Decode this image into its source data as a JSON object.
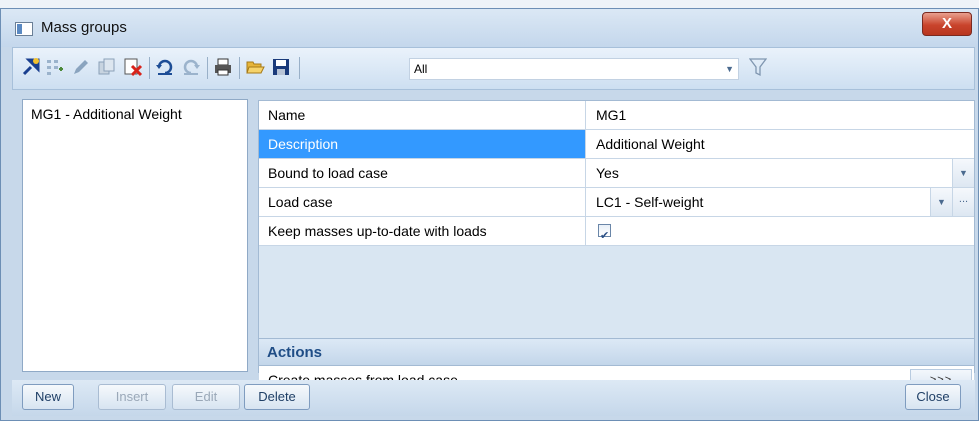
{
  "window": {
    "title": "Mass groups",
    "close_label": "X"
  },
  "toolbar": {
    "icons": [
      "new-item-icon",
      "insert-icon",
      "edit-icon",
      "copy-icon",
      "delete-icon",
      "undo-icon",
      "redo-icon",
      "print-icon",
      "open-icon",
      "save-icon"
    ],
    "filter_value": "All"
  },
  "list": {
    "items": [
      "MG1 - Additional Weight"
    ]
  },
  "properties": [
    {
      "name": "Name",
      "value": "MG1"
    },
    {
      "name": "Description",
      "value": "Additional Weight"
    },
    {
      "name": "Bound to load case",
      "value": "Yes"
    },
    {
      "name": "Load case",
      "value": "LC1 - Self-weight"
    },
    {
      "name": "Keep masses up-to-date with loads",
      "checked": true
    }
  ],
  "actions": {
    "header": "Actions",
    "items": [
      {
        "label": "Create masses from load case",
        "button": ">>>"
      }
    ]
  },
  "buttons": {
    "new": "New",
    "insert": "Insert",
    "edit": "Edit",
    "delete": "Delete",
    "close": "Close"
  },
  "colors": {
    "selection": "#3399ff",
    "accent": "#1f4d86",
    "close_red": "#c9442c"
  }
}
